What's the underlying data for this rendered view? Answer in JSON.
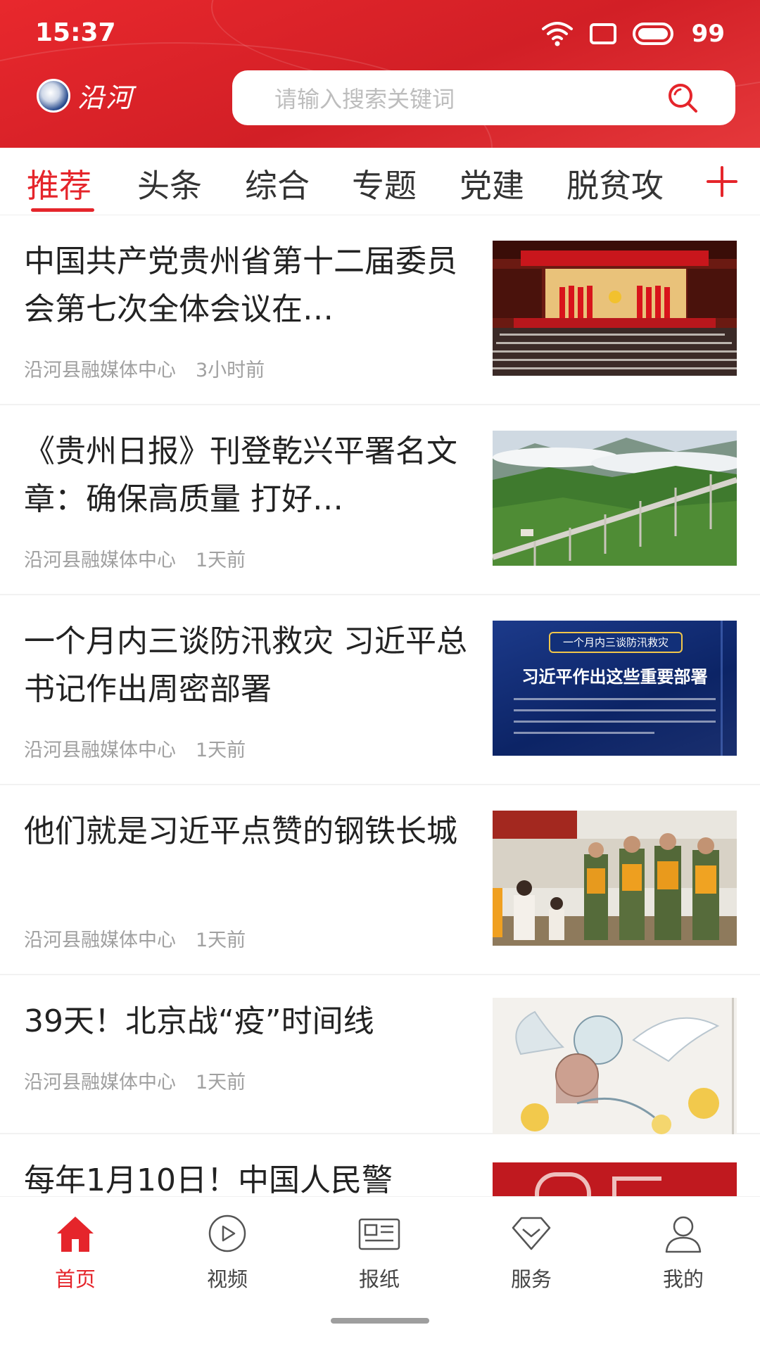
{
  "status_bar": {
    "time": "15:37",
    "battery": "99"
  },
  "header": {
    "logo_text": "沿河",
    "search_placeholder": "请输入搜索关键词"
  },
  "tabs": [
    {
      "label": "推荐",
      "active": true
    },
    {
      "label": "头条",
      "active": false
    },
    {
      "label": "综合",
      "active": false
    },
    {
      "label": "专题",
      "active": false
    },
    {
      "label": "党建",
      "active": false
    },
    {
      "label": "脱贫攻",
      "active": false
    }
  ],
  "articles": [
    {
      "title": "中国共产党贵州省第十二届委员会第七次全体会议在…",
      "source": "沿河县融媒体中心",
      "time": "3小时前",
      "thumb": "meeting-hall-photo"
    },
    {
      "title": "《贵州日报》刊登乾兴平署名文章：确保高质量 打好…",
      "source": "沿河县融媒体中心",
      "time": "1天前",
      "thumb": "mountain-viaduct-photo"
    },
    {
      "title": "一个月内三谈防汛救灾 习近平总书记作出周密部署",
      "source": "沿河县融媒体中心",
      "time": "1天前",
      "thumb": "flood-poster",
      "thumb_text": {
        "badge": "一个月内三谈防汛救灾",
        "headline": "习近平作出这些重要部署"
      }
    },
    {
      "title": "他们就是习近平点赞的钢铁长城",
      "source": "沿河县融媒体中心",
      "time": "1天前",
      "thumb": "soldiers-salute-photo"
    },
    {
      "title": "39天！北京战“疫”时间线",
      "source": "沿河县融媒体中心",
      "time": "1天前",
      "thumb": "illustration-angel"
    },
    {
      "title": "每年1月10日！中国人民警",
      "source": "",
      "time": "",
      "thumb": "red-banner"
    }
  ],
  "bottom_nav": [
    {
      "label": "首页",
      "icon": "home-icon",
      "active": true
    },
    {
      "label": "视频",
      "icon": "play-icon",
      "active": false
    },
    {
      "label": "报纸",
      "icon": "newspaper-icon",
      "active": false
    },
    {
      "label": "服务",
      "icon": "diamond-icon",
      "active": false
    },
    {
      "label": "我的",
      "icon": "user-icon",
      "active": false
    }
  ],
  "colors": {
    "brand_red": "#e5252b",
    "header_red": "#d21f26",
    "meta_gray": "#a0a0a0"
  }
}
